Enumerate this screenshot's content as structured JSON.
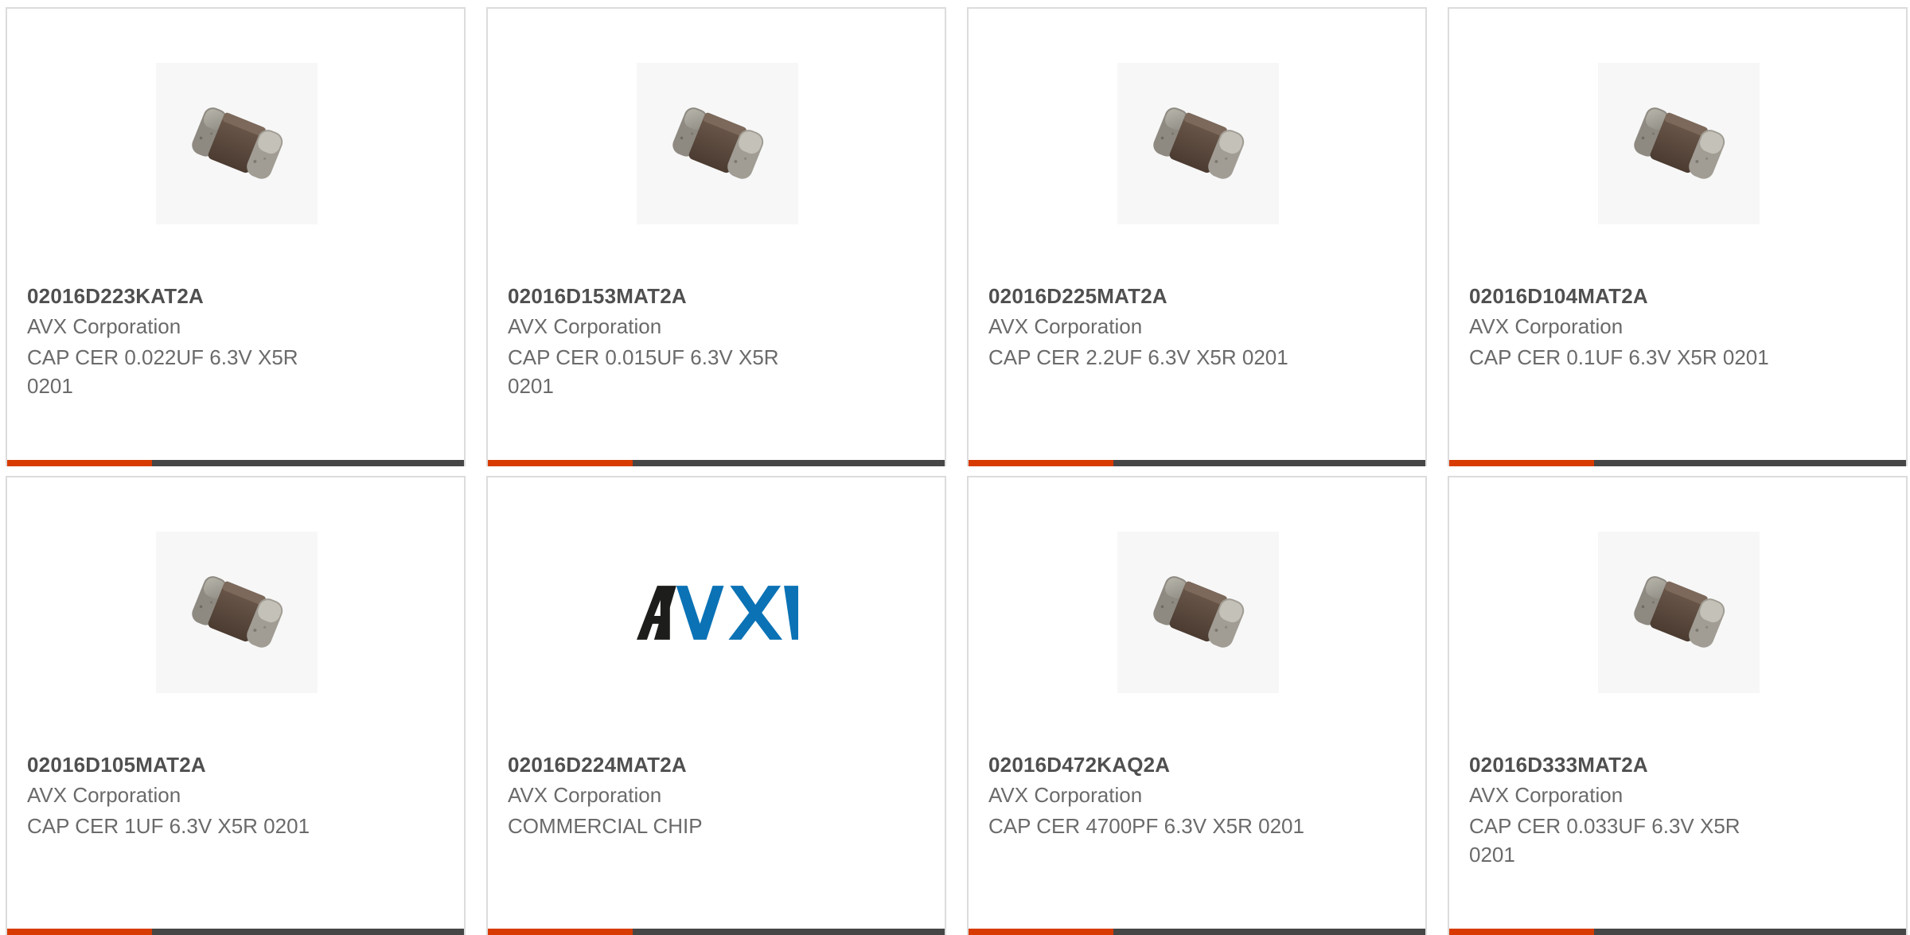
{
  "products": [
    {
      "part": "02016D223KAT2A",
      "manufacturer": "AVX Corporation",
      "description": "CAP CER 0.022UF 6.3V X5R 0201",
      "image": "capacitor-chip"
    },
    {
      "part": "02016D153MAT2A",
      "manufacturer": "AVX Corporation",
      "description": "CAP CER 0.015UF 6.3V X5R 0201",
      "image": "capacitor-chip"
    },
    {
      "part": "02016D225MAT2A",
      "manufacturer": "AVX Corporation",
      "description": "CAP CER 2.2UF 6.3V X5R 0201",
      "image": "capacitor-chip"
    },
    {
      "part": "02016D104MAT2A",
      "manufacturer": "AVX Corporation",
      "description": "CAP CER 0.1UF 6.3V X5R 0201",
      "image": "capacitor-chip"
    },
    {
      "part": "02016D105MAT2A",
      "manufacturer": "AVX Corporation",
      "description": "CAP CER 1UF 6.3V X5R 0201",
      "image": "capacitor-chip"
    },
    {
      "part": "02016D224MAT2A",
      "manufacturer": "AVX Corporation",
      "description": "COMMERCIAL CHIP",
      "image": "avx-logo",
      "logo_text": "AVX"
    },
    {
      "part": "02016D472KAQ2A",
      "manufacturer": "AVX Corporation",
      "description": "CAP CER 4700PF 6.3V X5R 0201",
      "image": "capacitor-chip"
    },
    {
      "part": "02016D333MAT2A",
      "manufacturer": "AVX Corporation",
      "description": "CAP CER 0.033UF 6.3V X5R 0201",
      "image": "capacitor-chip"
    }
  ],
  "colors": {
    "accent": "#d83b01",
    "bar": "#464646",
    "logo_dark": "#1d1d1b",
    "logo_blue": "#0b72b5"
  }
}
